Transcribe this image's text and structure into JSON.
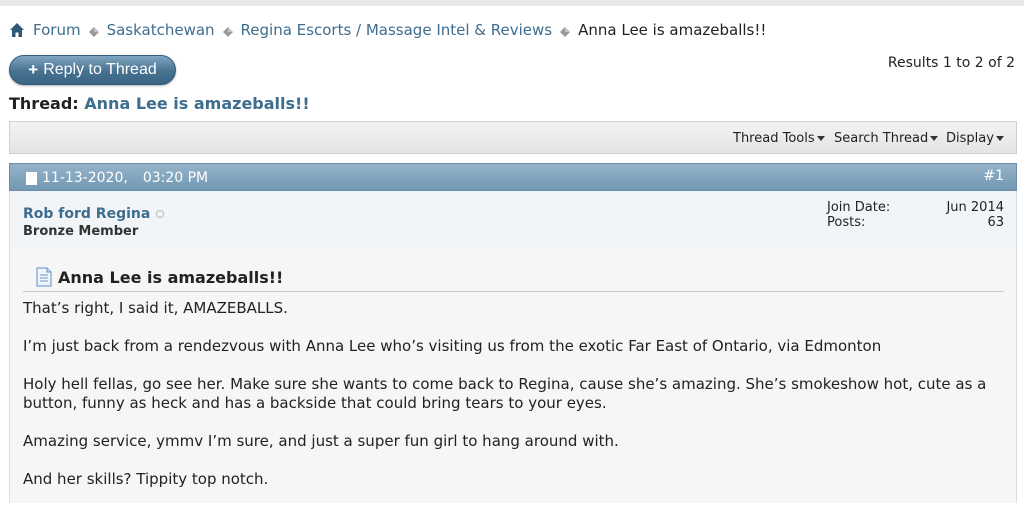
{
  "breadcrumb": {
    "items": [
      "Forum",
      "Saskatchewan",
      "Regina Escorts / Massage Intel & Reviews"
    ],
    "current": "Anna Lee is amazeballs!!"
  },
  "toolbar": {
    "reply_label": "Reply to Thread",
    "results_text": "Results 1 to 2 of 2"
  },
  "thread": {
    "label": "Thread:",
    "title": "Anna Lee is amazeballs!!"
  },
  "thread_tools": {
    "items": [
      "Thread Tools",
      "Search Thread",
      "Display"
    ]
  },
  "post": {
    "date": "11-13-2020,",
    "time": "03:20 PM",
    "number": "#1",
    "username": "Rob ford Regina",
    "usertitle": "Bronze Member",
    "join_date_label": "Join Date:",
    "join_date_value": "Jun 2014",
    "posts_label": "Posts:",
    "posts_value": "63",
    "title": "Anna Lee is amazeballs!!",
    "paragraphs": [
      "That’s right, I said it, AMAZEBALLS.",
      "I’m just back from a rendezvous with Anna Lee who’s visiting us from the exotic Far East of Ontario, via Edmonton",
      "Holy hell fellas, go see her. Make sure she wants to come back to Regina, cause she’s amazing. She’s smokeshow hot, cute as a button, funny as heck and has a backside that could bring tears to your eyes.",
      "Amazing service, ymmv I’m sure, and just a super fun girl to hang around with.",
      "And her skills? Tippity top notch."
    ]
  },
  "colors": {
    "link": "#3e6d8e",
    "header_bar": "#7fa2bb",
    "user_bg": "#f1f5f8"
  }
}
